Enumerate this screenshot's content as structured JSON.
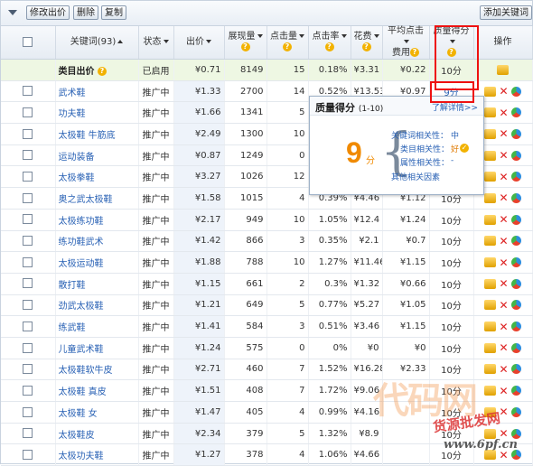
{
  "toolbar": {
    "modify_bid_label": "修改出价",
    "delete_label": "删除",
    "copy_label": "复制",
    "add_keyword_label": "添加关键词"
  },
  "columns": {
    "keyword": "关键词(93)",
    "status": "状态",
    "bid": "出价",
    "impressions": "展现量",
    "clicks": "点击量",
    "ctr": "点击率",
    "cost": "花费",
    "avg_cpc_line1": "平均点击",
    "avg_cpc_line2": "费用",
    "quality_score": "质量得分",
    "actions": "操作"
  },
  "category_row": {
    "keyword": "类目出价",
    "status": "已启用",
    "bid": "¥0.71",
    "impressions": "8149",
    "clicks": "15",
    "ctr": "0.18%",
    "cost": "¥3.31",
    "avg_cpc": "¥0.22",
    "quality": "10分"
  },
  "rows": [
    {
      "keyword": "武术鞋",
      "status": "推广中",
      "bid": "¥1.33",
      "impressions": "2700",
      "clicks": "14",
      "ctr": "0.52%",
      "cost": "¥13.53",
      "avg_cpc": "¥0.97",
      "quality": "9分"
    },
    {
      "keyword": "功夫鞋",
      "status": "推广中",
      "bid": "¥1.66",
      "impressions": "1341",
      "clicks": "5",
      "ctr": "",
      "cost": "",
      "avg_cpc": "",
      "quality": ""
    },
    {
      "keyword": "太极鞋 牛筋底",
      "status": "推广中",
      "bid": "¥2.49",
      "impressions": "1300",
      "clicks": "10",
      "ctr": "",
      "cost": "",
      "avg_cpc": "",
      "quality": ""
    },
    {
      "keyword": "运动装备",
      "status": "推广中",
      "bid": "¥0.87",
      "impressions": "1249",
      "clicks": "0",
      "ctr": "",
      "cost": "",
      "avg_cpc": "",
      "quality": ""
    },
    {
      "keyword": "太极拳鞋",
      "status": "推广中",
      "bid": "¥3.27",
      "impressions": "1026",
      "clicks": "12",
      "ctr": "",
      "cost": "",
      "avg_cpc": "",
      "quality": ""
    },
    {
      "keyword": "奥之武太极鞋",
      "status": "推广中",
      "bid": "¥1.58",
      "impressions": "1015",
      "clicks": "4",
      "ctr": "0.39%",
      "cost": "¥4.46",
      "avg_cpc": "¥1.12",
      "quality": "10分"
    },
    {
      "keyword": "太极练功鞋",
      "status": "推广中",
      "bid": "¥2.17",
      "impressions": "949",
      "clicks": "10",
      "ctr": "1.05%",
      "cost": "¥12.4",
      "avg_cpc": "¥1.24",
      "quality": "10分"
    },
    {
      "keyword": "练功鞋武术",
      "status": "推广中",
      "bid": "¥1.42",
      "impressions": "866",
      "clicks": "3",
      "ctr": "0.35%",
      "cost": "¥2.1",
      "avg_cpc": "¥0.7",
      "quality": "10分"
    },
    {
      "keyword": "太极运动鞋",
      "status": "推广中",
      "bid": "¥1.88",
      "impressions": "788",
      "clicks": "10",
      "ctr": "1.27%",
      "cost": "¥11.46",
      "avg_cpc": "¥1.15",
      "quality": "10分"
    },
    {
      "keyword": "散打鞋",
      "status": "推广中",
      "bid": "¥1.15",
      "impressions": "661",
      "clicks": "2",
      "ctr": "0.3%",
      "cost": "¥1.32",
      "avg_cpc": "¥0.66",
      "quality": "10分"
    },
    {
      "keyword": "劲武太极鞋",
      "status": "推广中",
      "bid": "¥1.21",
      "impressions": "649",
      "clicks": "5",
      "ctr": "0.77%",
      "cost": "¥5.27",
      "avg_cpc": "¥1.05",
      "quality": "10分"
    },
    {
      "keyword": "练武鞋",
      "status": "推广中",
      "bid": "¥1.41",
      "impressions": "584",
      "clicks": "3",
      "ctr": "0.51%",
      "cost": "¥3.46",
      "avg_cpc": "¥1.15",
      "quality": "10分"
    },
    {
      "keyword": "儿童武术鞋",
      "status": "推广中",
      "bid": "¥1.24",
      "impressions": "575",
      "clicks": "0",
      "ctr": "0%",
      "cost": "¥0",
      "avg_cpc": "¥0",
      "quality": "10分"
    },
    {
      "keyword": "太极鞋软牛皮",
      "status": "推广中",
      "bid": "¥2.71",
      "impressions": "460",
      "clicks": "7",
      "ctr": "1.52%",
      "cost": "¥16.28",
      "avg_cpc": "¥2.33",
      "quality": "10分"
    },
    {
      "keyword": "太极鞋 真皮",
      "status": "推广中",
      "bid": "¥1.51",
      "impressions": "408",
      "clicks": "7",
      "ctr": "1.72%",
      "cost": "¥9.06",
      "avg_cpc": "",
      "quality": "10分"
    },
    {
      "keyword": "太极鞋 女",
      "status": "推广中",
      "bid": "¥1.47",
      "impressions": "405",
      "clicks": "4",
      "ctr": "0.99%",
      "cost": "¥4.16",
      "avg_cpc": "",
      "quality": "10分"
    },
    {
      "keyword": "太极鞋皮",
      "status": "推广中",
      "bid": "¥2.34",
      "impressions": "379",
      "clicks": "5",
      "ctr": "1.32%",
      "cost": "¥8.9",
      "avg_cpc": "",
      "quality": "10分"
    },
    {
      "keyword": "太极功夫鞋",
      "status": "推广中",
      "bid": "¥1.27",
      "impressions": "378",
      "clicks": "4",
      "ctr": "1.06%",
      "avg_cpc": "",
      "cost": "¥4.66",
      "quality": "10分"
    }
  ],
  "popup": {
    "title": "质量得分",
    "range": "(1-10)",
    "details_link": "了解详情>>",
    "score": "9",
    "score_unit": "分",
    "factors": [
      {
        "label": "关键词相关性：",
        "value": "中"
      },
      {
        "label": "类目相关性：",
        "value": "好"
      },
      {
        "label": "属性相关性：",
        "value": "-"
      }
    ],
    "other_factors": "其他相关因素"
  },
  "watermark": {
    "brand": "代码网",
    "sub": "货源批发网",
    "url": "www.6pf.cn"
  },
  "colors": {
    "accent_red": "#e11111",
    "link_blue": "#2a62b5",
    "score_orange": "#f08a00",
    "category_row_bg": "#eef7e3"
  }
}
